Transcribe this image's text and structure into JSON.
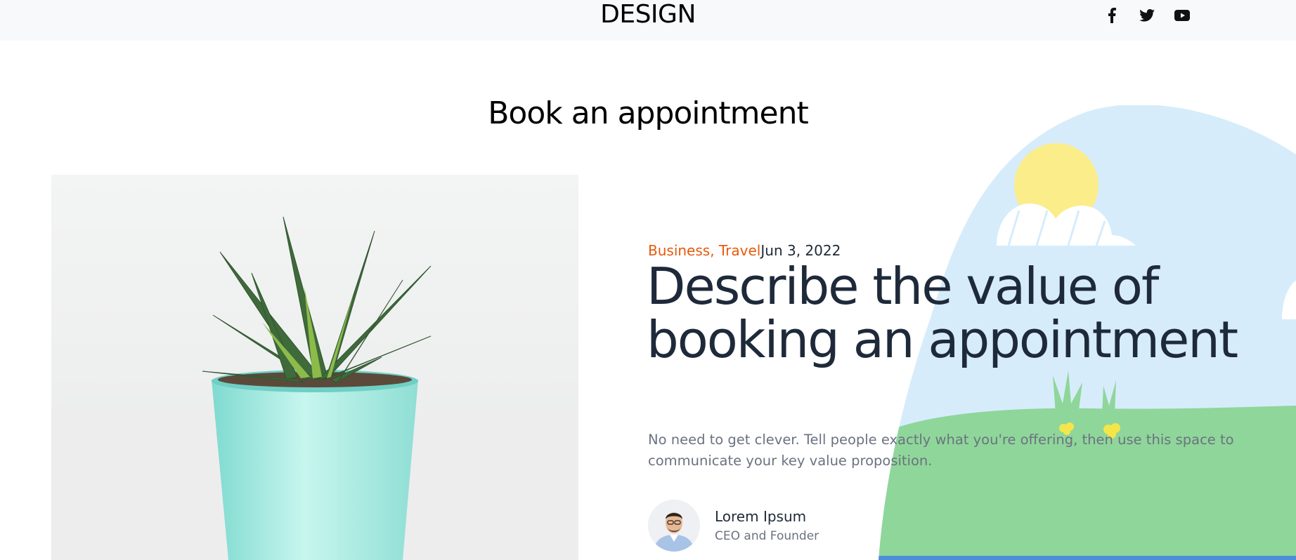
{
  "header": {
    "logo": "DESIGN",
    "social": [
      {
        "icon": "facebook-icon"
      },
      {
        "icon": "twitter-icon"
      },
      {
        "icon": "youtube-icon"
      }
    ]
  },
  "section": {
    "title": "Book an appointment"
  },
  "article": {
    "categories": "Business, Travel",
    "date": "Jun 3, 2022",
    "headline": "Describe the value of booking an appointment",
    "description": "No need to get clever. Tell people exactly what you're offering, then use this space to communicate your key value proposition.",
    "author": {
      "name": "Lorem Ipsum",
      "role": "CEO and Founder"
    }
  },
  "colors": {
    "accent": "#e8590c",
    "heading": "#1e2a3a",
    "sky": "#d6ecfb",
    "grass": "#8fd69a"
  }
}
